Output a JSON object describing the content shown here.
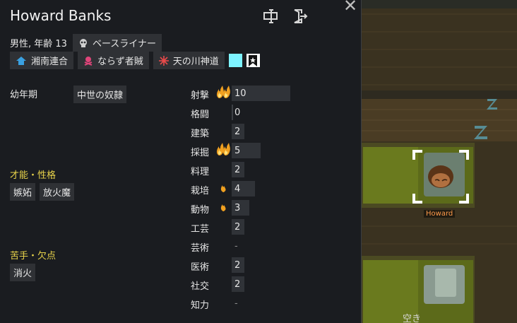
{
  "pawn": {
    "name": "Howard Banks",
    "info": "男性, 年齢 13",
    "backstory_chip": "ベースライナー",
    "ideo": "湘南連合",
    "faction": "ならず者賊",
    "title_chip": "天の川神道",
    "favorite_color": "#7df3ff"
  },
  "childhood": {
    "label": "幼年期",
    "value": "中世の奴隷"
  },
  "traits": {
    "heading": "才能・性格",
    "items": [
      "嫉妬",
      "放火魔"
    ]
  },
  "incapable": {
    "heading": "苦手・欠点",
    "items": [
      "消火"
    ]
  },
  "skills": [
    {
      "name": "射撃",
      "level": "10",
      "passion": "major"
    },
    {
      "name": "格闘",
      "level": "0",
      "passion": "none"
    },
    {
      "name": "建築",
      "level": "2",
      "passion": "none"
    },
    {
      "name": "採掘",
      "level": "5",
      "passion": "major"
    },
    {
      "name": "料理",
      "level": "2",
      "passion": "none"
    },
    {
      "name": "栽培",
      "level": "4",
      "passion": "minor"
    },
    {
      "name": "動物",
      "level": "3",
      "passion": "minor"
    },
    {
      "name": "工芸",
      "level": "2",
      "passion": "none"
    },
    {
      "name": "芸術",
      "level": "-",
      "passion": "none"
    },
    {
      "name": "医術",
      "level": "2",
      "passion": "none"
    },
    {
      "name": "社交",
      "level": "2",
      "passion": "none"
    },
    {
      "name": "知力",
      "level": "-",
      "passion": "none"
    }
  ],
  "world": {
    "pawn_label": "Howard",
    "bed_label": "空き"
  }
}
